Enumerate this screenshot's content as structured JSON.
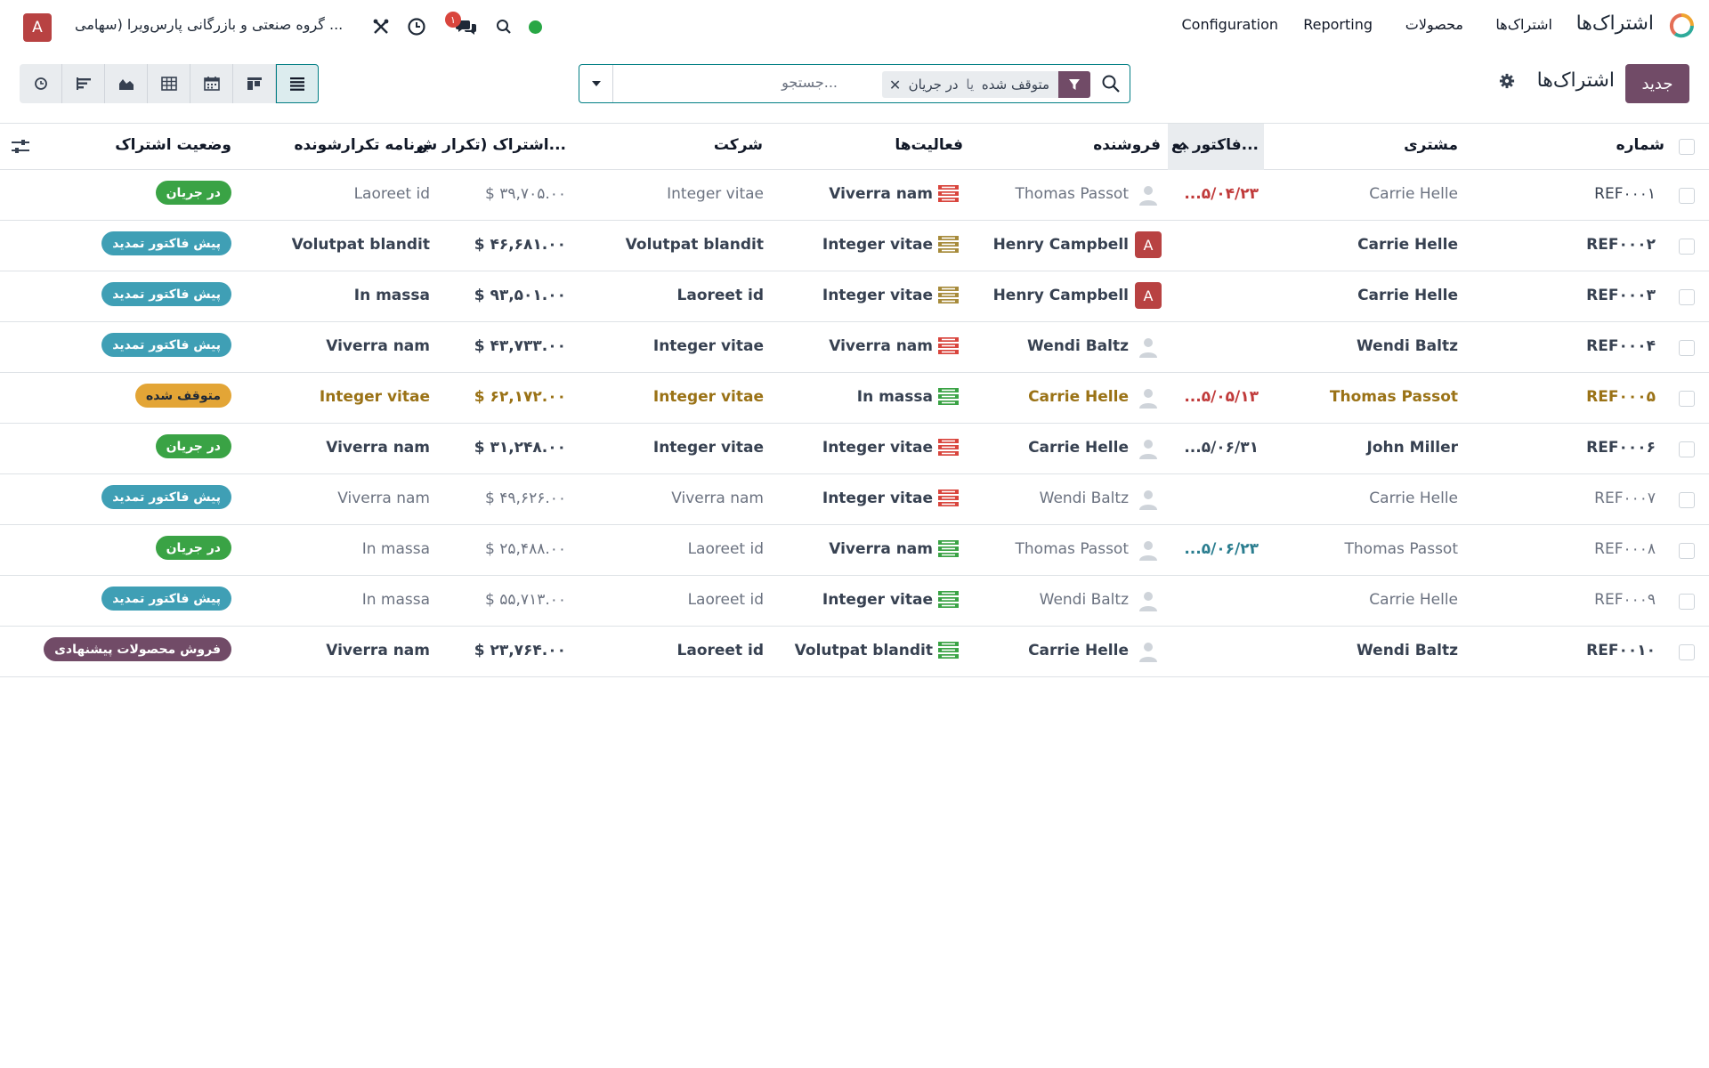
{
  "navbar": {
    "app_name": "اشتراک‌ها",
    "menus": [
      "اشتراک‌ها",
      "محصولات",
      "Reporting",
      "Configuration"
    ],
    "company": "گروه صنعتی و بازرگانی پارس‌ویرا (سهامی ...",
    "user_initial": "A",
    "messages_count": "۱"
  },
  "control_panel": {
    "new_label": "جدید",
    "title": "اشتراک‌ها",
    "search": {
      "facet_value_1": "در جریان",
      "facet_or": "یا",
      "facet_value_2": "متوقف شده",
      "placeholder": "جستجو..."
    },
    "views": [
      "list-icon",
      "kanban-icon",
      "calendar-icon",
      "pivot-icon",
      "graph-icon",
      "cohort-icon",
      "activity-icon"
    ]
  },
  "table": {
    "columns": {
      "number": "شماره",
      "customer": "مشتری",
      "next_invoice": "فاکتور بع...",
      "salesperson": "فروشنده",
      "activities": "فعالیت‌ها",
      "company": "شرکت",
      "recurring": "اشتراک (تکرار ش...",
      "plan": "برنامه تکرارشونده",
      "stage": "وضعیت اشتراک"
    },
    "rows": [
      {
        "ref": "REF۰۰۰۱",
        "customer": "Carrie Helle",
        "next_invoice": "...۵/۰۴/۲۳",
        "salesperson": "Thomas Passot",
        "activity": "Viverra nam",
        "company": "Integer vitae",
        "amount": "$ ۳۹,۷۰۵.۰۰",
        "plan": "Laoreet id",
        "stage": "در جریان"
      },
      {
        "ref": "REF۰۰۰۲",
        "customer": "Carrie Helle",
        "next_invoice": "",
        "salesperson": "Henry Campbell",
        "activity": "Integer vitae",
        "company": "Volutpat blandit",
        "amount": "$ ۴۶,۶۸۱.۰۰",
        "plan": "Volutpat blandit",
        "stage": "پیش فاکتور تمدید"
      },
      {
        "ref": "REF۰۰۰۳",
        "customer": "Carrie Helle",
        "next_invoice": "",
        "salesperson": "Henry Campbell",
        "activity": "Integer vitae",
        "company": "Laoreet id",
        "amount": "$ ۹۳,۵۰۱.۰۰",
        "plan": "In massa",
        "stage": "پیش فاکتور تمدید"
      },
      {
        "ref": "REF۰۰۰۴",
        "customer": "Wendi Baltz",
        "next_invoice": "",
        "salesperson": "Wendi Baltz",
        "activity": "Viverra nam",
        "company": "Integer vitae",
        "amount": "$ ۴۳,۷۳۳.۰۰",
        "plan": "Viverra nam",
        "stage": "پیش فاکتور تمدید"
      },
      {
        "ref": "REF۰۰۰۵",
        "customer": "Thomas Passot",
        "next_invoice": "...۵/۰۵/۱۳",
        "salesperson": "Carrie Helle",
        "activity": "In massa",
        "company": "Integer vitae",
        "amount": "$ ۶۲,۱۷۲.۰۰",
        "plan": "Integer vitae",
        "stage": "متوقف شده"
      },
      {
        "ref": "REF۰۰۰۶",
        "customer": "John Miller",
        "next_invoice": "...۵/۰۶/۳۱",
        "salesperson": "Carrie Helle",
        "activity": "Integer vitae",
        "company": "Integer vitae",
        "amount": "$ ۳۱,۲۴۸.۰۰",
        "plan": "Viverra nam",
        "stage": "در جریان"
      },
      {
        "ref": "REF۰۰۰۷",
        "customer": "Carrie Helle",
        "next_invoice": "",
        "salesperson": "Wendi Baltz",
        "activity": "Integer vitae",
        "company": "Viverra nam",
        "amount": "$ ۴۹,۶۲۶.۰۰",
        "plan": "Viverra nam",
        "stage": "پیش فاکتور تمدید"
      },
      {
        "ref": "REF۰۰۰۸",
        "customer": "Thomas Passot",
        "next_invoice": "...۵/۰۶/۲۳",
        "salesperson": "Thomas Passot",
        "activity": "Viverra nam",
        "company": "Laoreet id",
        "amount": "$ ۲۵,۴۸۸.۰۰",
        "plan": "In massa",
        "stage": "در جریان"
      },
      {
        "ref": "REF۰۰۰۹",
        "customer": "Carrie Helle",
        "next_invoice": "",
        "salesperson": "Wendi Baltz",
        "activity": "Integer vitae",
        "company": "Laoreet id",
        "amount": "$ ۵۵,۷۱۳.۰۰",
        "plan": "In massa",
        "stage": "پیش فاکتور تمدید"
      },
      {
        "ref": "REF۰۰۱۰",
        "customer": "Wendi Baltz",
        "next_invoice": "",
        "salesperson": "Carrie Helle",
        "activity": "Volutpat blandit",
        "company": "Laoreet id",
        "amount": "$ ۲۳,۷۶۴.۰۰",
        "plan": "Viverra nam",
        "stage": "فروش محصولات پیشنهادی"
      }
    ]
  },
  "colors": {
    "brand": "#714b67",
    "accent": "#017e84",
    "stage_in_progress": "#3aa345",
    "stage_renewal_quote": "#3f9fb5",
    "stage_paused": "#e3a536",
    "stage_upsell": "#714b67",
    "activity_overdue": "#d9453d",
    "activity_planned": "#3aa345",
    "activity_today": "#a78b3b"
  }
}
